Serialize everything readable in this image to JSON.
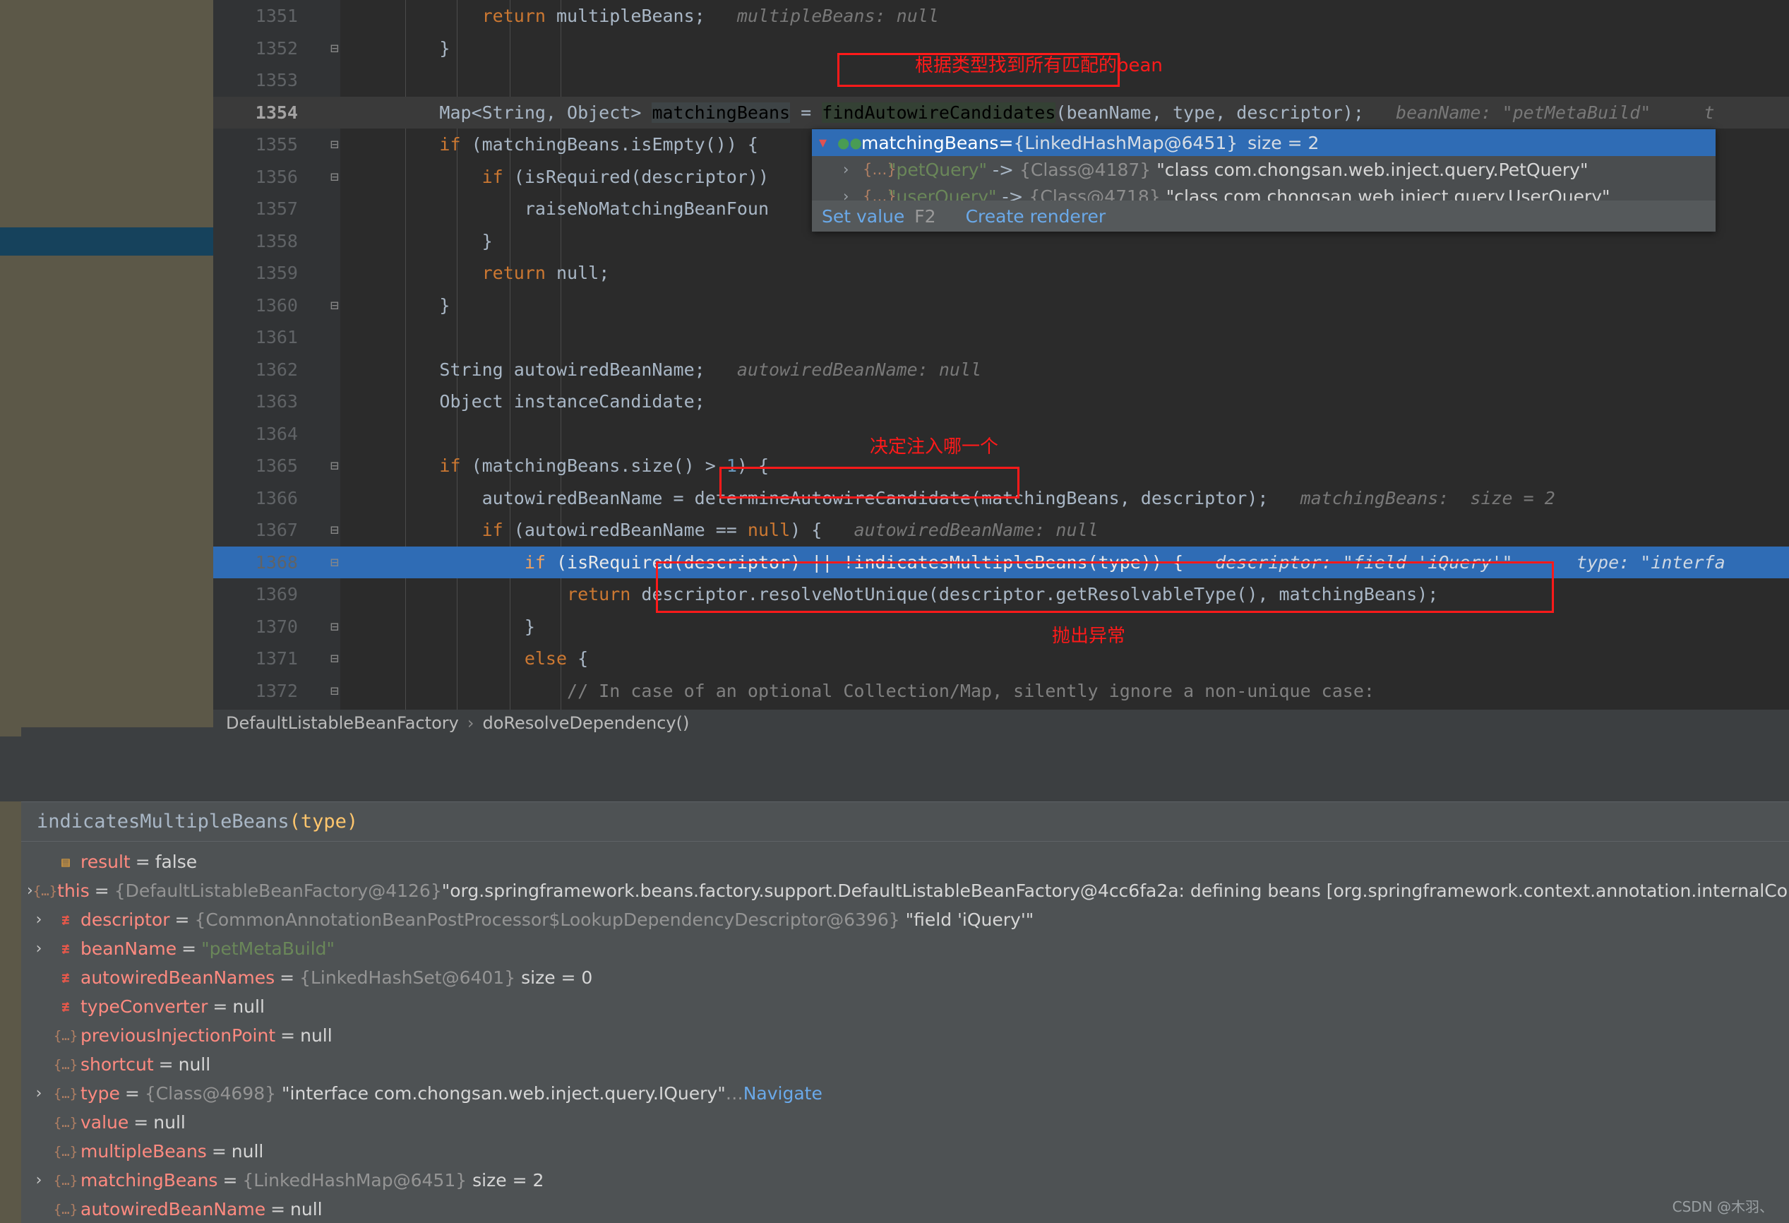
{
  "editor": {
    "lines": [
      {
        "num": "1351",
        "fold": "",
        "indent": 5,
        "state": "",
        "tokens": [
          {
            "t": "            ",
            "c": "txt"
          },
          {
            "t": "return",
            "c": "kw"
          },
          {
            "t": " multipleBeans;",
            "c": "txt"
          },
          {
            "t": "   multipleBeans: null",
            "c": "hint"
          }
        ]
      },
      {
        "num": "1352",
        "fold": "minus",
        "indent": 4,
        "state": "",
        "tokens": [
          {
            "t": "        }",
            "c": "txt"
          }
        ]
      },
      {
        "num": "1353",
        "fold": "",
        "indent": 0,
        "state": "",
        "tokens": []
      },
      {
        "num": "1354",
        "fold": "",
        "indent": 4,
        "state": "current",
        "bold": true,
        "tokens": [
          {
            "t": "        Map<String, Object> ",
            "c": "txt"
          },
          {
            "t": "matchingBeans",
            "c": "sel-ident"
          },
          {
            "t": " = ",
            "c": "txt"
          },
          {
            "t": "findAutowireCandidates",
            "c": "evalhl"
          },
          {
            "t": "(beanName, type, descriptor);",
            "c": "txt"
          },
          {
            "t": "   beanName: \"petMetaBuild\"",
            "c": "hint"
          },
          {
            "t": "     t",
            "c": "hint"
          }
        ]
      },
      {
        "num": "1355",
        "fold": "minus",
        "indent": 4,
        "state": "",
        "tokens": [
          {
            "t": "        ",
            "c": "txt"
          },
          {
            "t": "if",
            "c": "kw"
          },
          {
            "t": " (matchingBeans.isEmpty()) {",
            "c": "txt"
          }
        ]
      },
      {
        "num": "1356",
        "fold": "minus",
        "indent": 5,
        "state": "",
        "tokens": [
          {
            "t": "            ",
            "c": "txt"
          },
          {
            "t": "if",
            "c": "kw"
          },
          {
            "t": " (isRequired(descriptor))",
            "c": "txt"
          }
        ]
      },
      {
        "num": "1357",
        "fold": "",
        "indent": 6,
        "state": "",
        "tokens": [
          {
            "t": "                raiseNoMatchingBeanFoun",
            "c": "txt"
          }
        ]
      },
      {
        "num": "1358",
        "fold": "",
        "indent": 5,
        "state": "",
        "tokens": [
          {
            "t": "            }",
            "c": "txt"
          }
        ]
      },
      {
        "num": "1359",
        "fold": "",
        "indent": 5,
        "state": "",
        "tokens": [
          {
            "t": "            ",
            "c": "txt"
          },
          {
            "t": "return",
            "c": "kw"
          },
          {
            "t": " null;",
            "c": "txt"
          }
        ]
      },
      {
        "num": "1360",
        "fold": "minus",
        "indent": 4,
        "state": "",
        "tokens": [
          {
            "t": "        }",
            "c": "txt"
          }
        ]
      },
      {
        "num": "1361",
        "fold": "",
        "indent": 0,
        "state": "",
        "tokens": []
      },
      {
        "num": "1362",
        "fold": "",
        "indent": 4,
        "state": "",
        "tokens": [
          {
            "t": "        String autowiredBeanName;",
            "c": "txt"
          },
          {
            "t": "   autowiredBeanName: null",
            "c": "hint"
          }
        ]
      },
      {
        "num": "1363",
        "fold": "",
        "indent": 4,
        "state": "",
        "tokens": [
          {
            "t": "        Object instanceCandidate;",
            "c": "txt"
          }
        ]
      },
      {
        "num": "1364",
        "fold": "",
        "indent": 0,
        "state": "",
        "tokens": []
      },
      {
        "num": "1365",
        "fold": "minus",
        "indent": 4,
        "state": "",
        "tokens": [
          {
            "t": "        ",
            "c": "txt"
          },
          {
            "t": "if",
            "c": "kw"
          },
          {
            "t": " (matchingBeans.size() > ",
            "c": "txt"
          },
          {
            "t": "1",
            "c": "num"
          },
          {
            "t": ") {",
            "c": "txt"
          }
        ]
      },
      {
        "num": "1366",
        "fold": "",
        "indent": 5,
        "state": "",
        "tokens": [
          {
            "t": "            autowiredBeanName = determineAutowireCandidate(matchingBeans, descriptor);",
            "c": "txt"
          },
          {
            "t": "   matchingBeans:  size = 2",
            "c": "hint"
          }
        ]
      },
      {
        "num": "1367",
        "fold": "minus",
        "indent": 5,
        "state": "",
        "tokens": [
          {
            "t": "            ",
            "c": "txt"
          },
          {
            "t": "if",
            "c": "kw"
          },
          {
            "t": " (autowiredBeanName == ",
            "c": "txt"
          },
          {
            "t": "null",
            "c": "kw"
          },
          {
            "t": ") {",
            "c": "txt"
          },
          {
            "t": "   autowiredBeanName: null",
            "c": "hint"
          }
        ]
      },
      {
        "num": "1368",
        "fold": "minus",
        "indent": 6,
        "state": "exec",
        "tokens": [
          {
            "t": "                ",
            "c": "txt"
          },
          {
            "t": "if",
            "c": "kw"
          },
          {
            "t": " (isRequired(descriptor) || !indicatesMultipleBeans(type)) {",
            "c": "txt"
          },
          {
            "t": "   descriptor: \"field 'iQuery'\"",
            "c": "hint"
          },
          {
            "t": "      type: \"interfa",
            "c": "hint"
          }
        ]
      },
      {
        "num": "1369",
        "fold": "",
        "indent": 7,
        "state": "",
        "tokens": [
          {
            "t": "                    ",
            "c": "txt"
          },
          {
            "t": "return",
            "c": "kw"
          },
          {
            "t": " descriptor.resolveNotUnique(descriptor.getResolvableType(), matchingBeans);",
            "c": "txt"
          }
        ]
      },
      {
        "num": "1370",
        "fold": "minus",
        "indent": 6,
        "state": "",
        "tokens": [
          {
            "t": "                }",
            "c": "txt"
          }
        ]
      },
      {
        "num": "1371",
        "fold": "minus",
        "indent": 6,
        "state": "",
        "tokens": [
          {
            "t": "                ",
            "c": "txt"
          },
          {
            "t": "else",
            "c": "kw"
          },
          {
            "t": " {",
            "c": "txt"
          }
        ]
      },
      {
        "num": "1372",
        "fold": "minus",
        "indent": 7,
        "state": "",
        "tokens": [
          {
            "t": "                    // In case of an optional Collection/Map, silently ignore a non-unique case:",
            "c": "cmt"
          }
        ]
      }
    ]
  },
  "annotations": [
    {
      "id": "ann-find-bean",
      "text": "根据类型找到所有匹配的bean"
    },
    {
      "id": "ann-decide",
      "text": "决定注入哪一个"
    },
    {
      "id": "ann-throw",
      "text": "抛出异常"
    }
  ],
  "popup": {
    "caret_icon": "chevron-down-icon",
    "watch_icon": "watch-glasses-icon",
    "name": "matchingBeans",
    "separator": " = ",
    "ref": "{LinkedHashMap@6451}",
    "size": "size = 2",
    "rows": [
      {
        "expand": "›",
        "braces": "{…}",
        "key": "\"petQuery\"",
        "arrow": "->",
        "ref": "{Class@4187}",
        "value": "\"class com.chongsan.web.inject.query.PetQuery\""
      },
      {
        "expand": "›",
        "braces": "{…}",
        "key": "\"userQuery\"",
        "arrow": "->",
        "ref": "{Class@4718}",
        "value": "\"class com.chongsan.web.inject.query.UserQuery\""
      }
    ],
    "footer": {
      "set_value": "Set value",
      "set_value_shortcut": "F2",
      "create_renderer": "Create renderer"
    }
  },
  "breadcrumb": {
    "class": "DefaultListableBeanFactory",
    "separator": "›",
    "method": "doResolveDependency()"
  },
  "debugger": {
    "frame_title": {
      "method": "indicatesMultipleBeans",
      "params": "(type)"
    },
    "variables": [
      {
        "expand": "",
        "icon": "result-icon",
        "icon_glyph": "▤",
        "icon_kind": "result",
        "name": "result",
        "value_plain": "false"
      },
      {
        "expand": "›",
        "icon": "object-icon",
        "icon_glyph": "{…}",
        "icon_kind": "obj",
        "name": "this",
        "ref": "{DefaultListableBeanFactory@4126}",
        "value_str": "\"org.springframework.beans.factory.support.DefaultListableBeanFactory@4cc6fa2a: defining beans [org.springframework.context.annotation.internalConfigura"
      },
      {
        "expand": "›",
        "icon": "field-icon",
        "icon_glyph": "≢",
        "icon_kind": "field",
        "name": "descriptor",
        "ref": "{CommonAnnotationBeanPostProcessor$LookupDependencyDescriptor@6396}",
        "value_str": "\"field 'iQuery'\""
      },
      {
        "expand": "›",
        "icon": "field-icon",
        "icon_glyph": "≢",
        "icon_kind": "field",
        "name": "beanName",
        "value_green": "\"petMetaBuild\""
      },
      {
        "expand": "",
        "icon": "field-icon",
        "icon_glyph": "≢",
        "icon_kind": "field",
        "name": "autowiredBeanNames",
        "ref": "{LinkedHashSet@6401}",
        "value_plain": "size = 0"
      },
      {
        "expand": "",
        "icon": "field-icon",
        "icon_glyph": "≢",
        "icon_kind": "field",
        "name": "typeConverter",
        "value_plain": "null"
      },
      {
        "expand": "",
        "icon": "object-icon",
        "icon_glyph": "{…}",
        "icon_kind": "obj",
        "name": "previousInjectionPoint",
        "value_plain": "null"
      },
      {
        "expand": "",
        "icon": "object-icon",
        "icon_glyph": "{…}",
        "icon_kind": "obj",
        "name": "shortcut",
        "value_plain": "null"
      },
      {
        "expand": "›",
        "icon": "object-icon",
        "icon_glyph": "{…}",
        "icon_kind": "obj",
        "name": "type",
        "ref": "{Class@4698}",
        "value_str": "\"interface com.chongsan.web.inject.query.IQuery\"",
        "ellipsis": "…",
        "navigate": "Navigate"
      },
      {
        "expand": "",
        "icon": "object-icon",
        "icon_glyph": "{…}",
        "icon_kind": "obj",
        "name": "value",
        "value_plain": "null"
      },
      {
        "expand": "",
        "icon": "object-icon",
        "icon_glyph": "{…}",
        "icon_kind": "obj",
        "name": "multipleBeans",
        "value_plain": "null"
      },
      {
        "expand": "›",
        "icon": "object-icon",
        "icon_glyph": "{…}",
        "icon_kind": "obj",
        "name": "matchingBeans",
        "ref": "{LinkedHashMap@6451}",
        "value_plain": "size = 2"
      },
      {
        "expand": "",
        "icon": "object-icon",
        "icon_glyph": "{…}",
        "icon_kind": "obj",
        "name": "autowiredBeanName",
        "value_plain": "null"
      }
    ]
  },
  "watermark": "CSDN @木羽、",
  "colors": {
    "editor_bg": "#2b2b2b",
    "gutter_bg": "#313335",
    "exec_line": "#2f6cb5",
    "annotation_red": "#ff1a1a",
    "panel_bg": "#4e5254",
    "accent_link": "#6aa9e9"
  }
}
